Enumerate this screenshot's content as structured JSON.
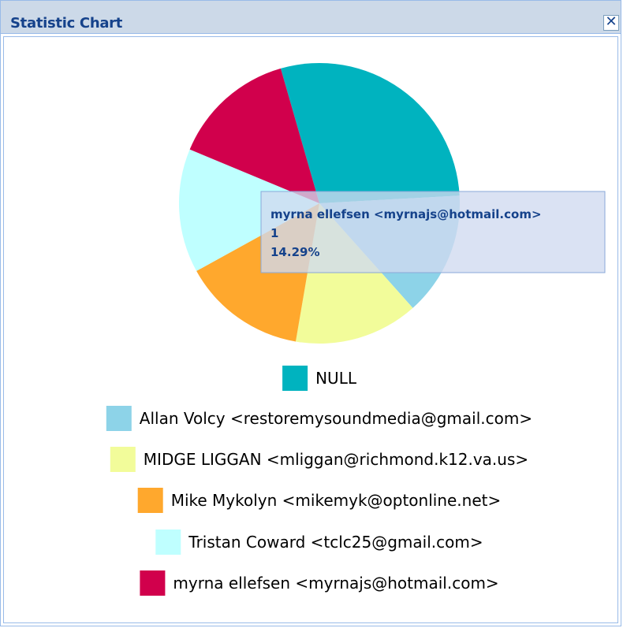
{
  "window": {
    "title": "Statistic Chart",
    "close_symbol": "✕"
  },
  "chart_data": {
    "type": "pie",
    "title": "",
    "series": [
      {
        "name": "NULL",
        "value": 2,
        "color": "#00b3bf"
      },
      {
        "name": "Allan Volcy <restoremysoundmedia@gmail.com>",
        "value": 1,
        "color": "#8dd3e8"
      },
      {
        "name": "MIDGE LIGGAN <mliggan@richmond.k12.va.us>",
        "value": 1,
        "color": "#f2fc9a"
      },
      {
        "name": "Mike Mykolyn <mikemyk@optonline.net>",
        "value": 1,
        "color": "#ffa82d"
      },
      {
        "name": "Tristan Coward <tclc25@gmail.com>",
        "value": 1,
        "color": "#bfffff"
      },
      {
        "name": "myrna ellefsen <myrnajs@hotmail.com>",
        "value": 1,
        "color": "#d1004c"
      }
    ],
    "legend_position": "bottom",
    "tooltip": {
      "name": "myrna ellefsen <myrnajs@hotmail.com>",
      "value": "1",
      "percent": "14.29%"
    }
  }
}
